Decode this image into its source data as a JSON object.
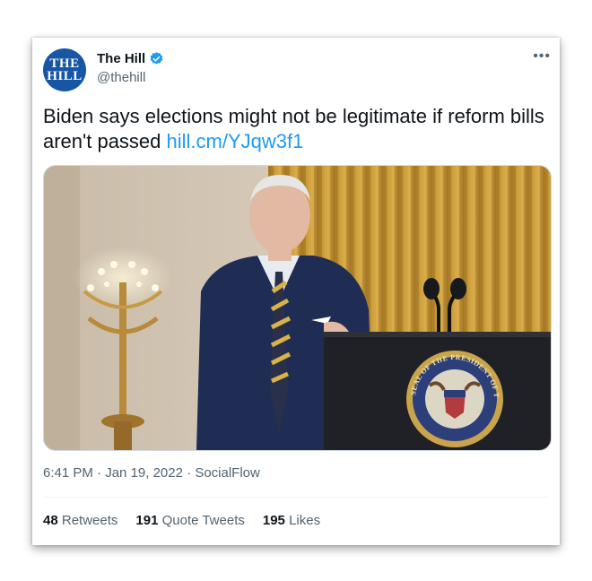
{
  "account": {
    "avatar_line1": "THE",
    "avatar_line2": "HILL",
    "name": "The Hill",
    "handle": "@thehill"
  },
  "tweet": {
    "text": "Biden says elections might not be legitimate if reform bills aren't passed ",
    "link": "hill.cm/YJqw3f1",
    "time": "6:41 PM",
    "date": "Jan 19, 2022",
    "source": "SocialFlow"
  },
  "stats": {
    "retweets_count": "48",
    "retweets_label": "Retweets",
    "quotes_count": "191",
    "quotes_label": "Quote Tweets",
    "likes_count": "195",
    "likes_label": "Likes"
  },
  "seal": {
    "text": "SEAL OF THE PRESIDENT OF THE UNITED STATES"
  },
  "icons": [
    "verified-badge-icon",
    "more-options-icon"
  ],
  "colors": {
    "link": "#1d9bf0",
    "avatar_bg": "#1656a4",
    "muted": "#536471"
  }
}
